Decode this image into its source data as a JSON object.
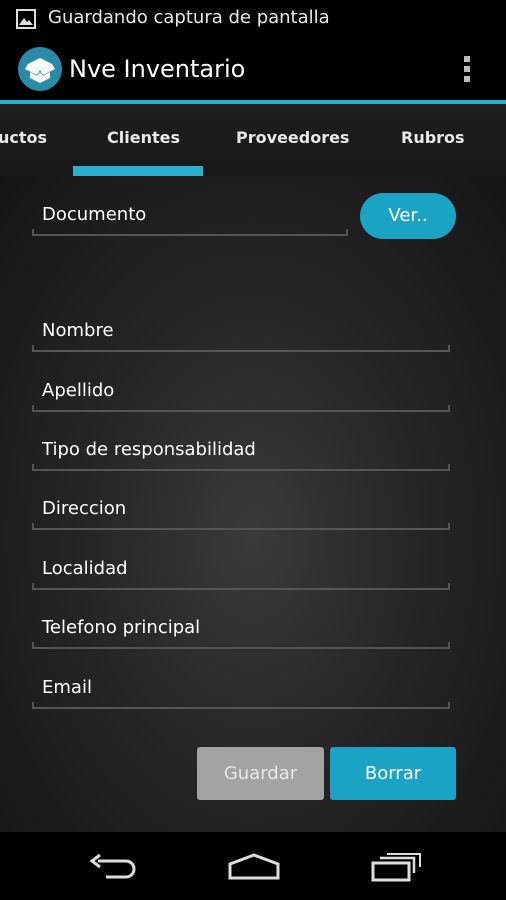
{
  "status_bar": {
    "icon": "image-icon",
    "text": "Guardando captura de pantalla"
  },
  "app_bar": {
    "title": "Nve Inventario",
    "logo": "dropbox-box-icon",
    "menu_icon": "overflow-menu-icon"
  },
  "tabs": [
    {
      "label": "uctos"
    },
    {
      "label": "Clientes",
      "selected": true
    },
    {
      "label": "Proveedores"
    },
    {
      "label": "Rubros"
    }
  ],
  "form": {
    "documento": "Documento",
    "ver_button": "Ver..",
    "fields": [
      {
        "label": "Nombre"
      },
      {
        "label": "Apellido"
      },
      {
        "label": "Tipo de responsabilidad"
      },
      {
        "label": "Direccion"
      },
      {
        "label": "Localidad"
      },
      {
        "label": "Telefono principal"
      },
      {
        "label": "Email"
      }
    ],
    "guardar_button": "Guardar",
    "borrar_button": "Borrar"
  },
  "nav_bar": {
    "back": "back-icon",
    "home": "home-icon",
    "recents": "recents-icon"
  },
  "colors": {
    "accent": "#2ab0d1",
    "button_accent": "#1aa3c4",
    "button_disabled": "#a3a3a3"
  }
}
